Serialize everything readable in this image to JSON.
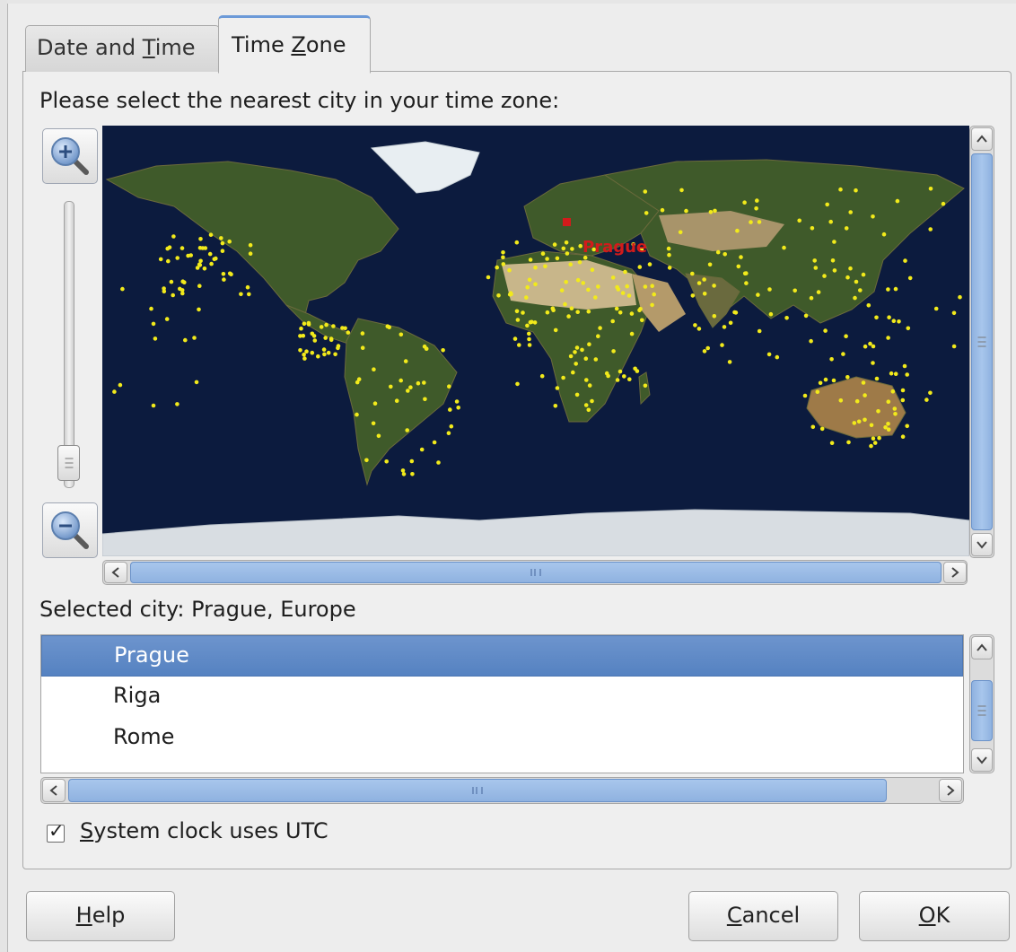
{
  "tabs": [
    {
      "label_pre": "Date and ",
      "label_key": "T",
      "label_post": "ime",
      "active": false
    },
    {
      "label_pre": "Time ",
      "label_key": "Z",
      "label_post": "one",
      "active": true
    }
  ],
  "timezone": {
    "prompt": "Please select the nearest city in your time zone:",
    "map_marker_label": "Prague",
    "selected_city_text": "Selected city: Prague, Europe",
    "cities": [
      {
        "name": "Prague",
        "selected": true
      },
      {
        "name": "Riga",
        "selected": false
      },
      {
        "name": "Rome",
        "selected": false
      }
    ],
    "utc_checked": true,
    "utc_label_key": "S",
    "utc_label_rest": "ystem clock uses UTC"
  },
  "buttons": {
    "help_key": "H",
    "help_rest": "elp",
    "cancel_key": "C",
    "cancel_rest": "ancel",
    "ok_key": "O",
    "ok_rest": "K"
  },
  "icons": {
    "zoom_in": "zoom-in-magnifier-icon",
    "zoom_out": "zoom-out-magnifier-icon"
  },
  "colors": {
    "ocean": "#0c1b3e",
    "city_dot": "#f2ea1b",
    "selected_marker": "#d21b1b",
    "selection": "#5f89c6"
  }
}
